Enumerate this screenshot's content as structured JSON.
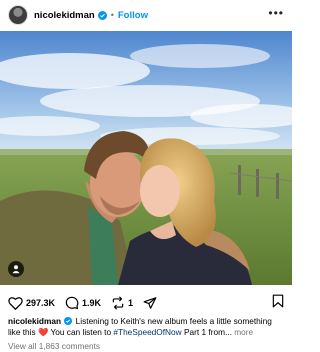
{
  "header": {
    "username": "nicolekidman",
    "separator": "•",
    "follow_label": "Follow",
    "more_label": "•••",
    "verified_color": "#0095f6"
  },
  "photo": {
    "alt": "Couple kissing in a green field under a blue sky",
    "sky_color": "#5d8fd1",
    "grass_color": "#7a9a45"
  },
  "actions": {
    "likes": "297.3K",
    "comments": "1.9K",
    "reposts": "1",
    "icons": [
      "heart-icon",
      "comment-icon",
      "repost-icon",
      "share-icon",
      "bookmark-icon"
    ]
  },
  "caption": {
    "username": "nicolekidman",
    "text_before": "Listening to Keith's new album feels a little something like this",
    "emoji": "❤️",
    "text_middle": "You can listen to",
    "hashtag": "#TheSpeedOfNow",
    "text_after": "Part 1 from...",
    "more_label": "more"
  },
  "comments_link": "View all 1,863 comments"
}
